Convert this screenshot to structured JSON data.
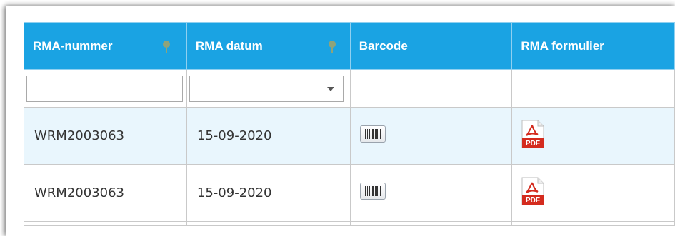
{
  "table": {
    "headers": [
      {
        "label": "RMA-nummer",
        "pinned": true
      },
      {
        "label": "RMA datum",
        "pinned": true
      },
      {
        "label": "Barcode",
        "pinned": false
      },
      {
        "label": "RMA formulier",
        "pinned": false
      }
    ],
    "filters": {
      "rma_nummer_value": "",
      "rma_datum_selected": ""
    },
    "rows": [
      {
        "rma_nummer": "WRM2003063",
        "rma_datum": "15-09-2020",
        "barcode_icon": "barcode-icon",
        "formulier_icon": "pdf-icon"
      },
      {
        "rma_nummer": "WRM2003063",
        "rma_datum": "15-09-2020",
        "barcode_icon": "barcode-icon",
        "formulier_icon": "pdf-icon"
      }
    ],
    "pdf_label": "PDF",
    "colors": {
      "header_bg": "#1aa3e3",
      "header_text": "#ffffff",
      "pin_icon": "#8fa37a",
      "row_alt_bg": "#e9f6fd",
      "pdf_red": "#d42b1e"
    }
  }
}
